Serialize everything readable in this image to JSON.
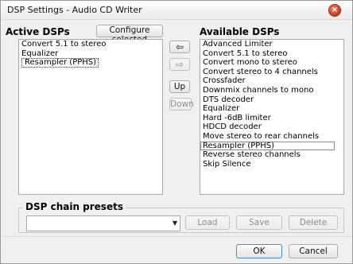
{
  "window": {
    "title": "DSP Settings - Audio CD Writer",
    "close_icon": "close-icon",
    "close_color": "#c6361a"
  },
  "active": {
    "heading": "Active DSPs",
    "configure_label": "Configure selected",
    "items": [
      {
        "label": "Convert 5.1 to stereo"
      },
      {
        "label": "Equalizer"
      },
      {
        "label": "Resampler (PPHS)"
      }
    ]
  },
  "controls": {
    "add_icon": "arrow-left-icon",
    "remove_icon": "arrow-right-icon",
    "up_label": "Up",
    "down_label": "Down"
  },
  "available": {
    "heading": "Available DSPs",
    "items": [
      {
        "label": "Advanced Limiter"
      },
      {
        "label": "Convert 5.1 to stereo"
      },
      {
        "label": "Convert mono to stereo"
      },
      {
        "label": "Convert stereo to 4 channels"
      },
      {
        "label": "Crossfader"
      },
      {
        "label": "Downmix channels to mono"
      },
      {
        "label": "DTS decoder"
      },
      {
        "label": "Equalizer"
      },
      {
        "label": "Hard -6dB limiter"
      },
      {
        "label": "HDCD decoder"
      },
      {
        "label": "Move stereo to rear channels"
      },
      {
        "label": "Resampler (PPHS)"
      },
      {
        "label": "Reverse stereo channels"
      },
      {
        "label": "Skip Silence"
      }
    ]
  },
  "presets": {
    "heading": "DSP chain presets",
    "combo_value": "",
    "load_label": "Load",
    "save_label": "Save",
    "delete_label": "Delete"
  },
  "footer": {
    "ok_label": "OK",
    "cancel_label": "Cancel"
  }
}
